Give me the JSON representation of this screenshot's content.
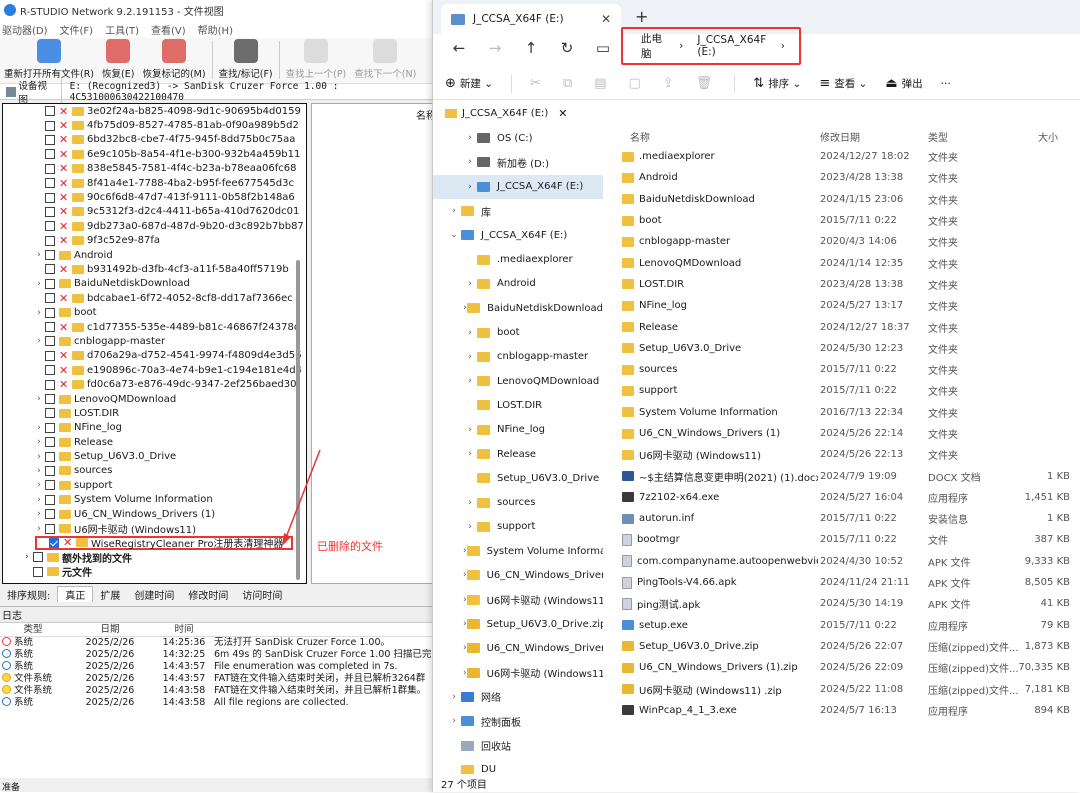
{
  "rstudio": {
    "title": "R-STUDIO Network 9.2.191153 - 文件视图",
    "menu": [
      "驱动器(D)",
      "文件(F)",
      "工具(T)",
      "查看(V)",
      "帮助(H)"
    ],
    "toolbar": [
      {
        "label": "重新打开所有文件(R)",
        "icon": "refresh-icon",
        "disabled": false
      },
      {
        "label": "恢复(E)",
        "icon": "recover-icon",
        "disabled": false
      },
      {
        "label": "恢复标记的(M)",
        "icon": "recover-marked-icon",
        "disabled": false
      },
      {
        "label": "查找/标记(F)",
        "icon": "binoculars-icon",
        "disabled": false
      },
      {
        "label": "查找上一个(P)",
        "icon": "find-prev-icon",
        "disabled": true
      },
      {
        "label": "查找下一个(N)",
        "icon": "find-next-icon",
        "disabled": true
      }
    ],
    "device_view": "设备视图",
    "path": "E: (Recognized3) -> SanDisk Cruzer Force 1.00 : 4C531000630422100470",
    "right_header": "名称",
    "tree": [
      {
        "name": "3e02f24a-b825-4098-9d1c-90695b4d0159",
        "deleted": true,
        "expand": false
      },
      {
        "name": "4fb75d09-8527-4785-81ab-0f90a989b5d2",
        "deleted": true,
        "expand": false
      },
      {
        "name": "6bd32bc8-cbe7-4f75-945f-8dd75b0c75aa",
        "deleted": true,
        "expand": false
      },
      {
        "name": "6e9c105b-8a54-4f1e-b300-932b4a459b11",
        "deleted": true,
        "expand": false
      },
      {
        "name": "838e5845-7581-4f4c-b23a-b78eaa06fc68",
        "deleted": true,
        "expand": false
      },
      {
        "name": "8f41a4e1-7788-4ba2-b95f-fee677545d3c",
        "deleted": true,
        "expand": false
      },
      {
        "name": "90c6f6d8-47d7-413f-9111-0b58f2b148a6",
        "deleted": true,
        "expand": false
      },
      {
        "name": "9c5312f3-d2c4-4411-b65a-410d7620dc01",
        "deleted": true,
        "expand": false
      },
      {
        "name": "9db273a0-687d-487d-9b20-d3c892b7bb87",
        "deleted": true,
        "expand": false
      },
      {
        "name": "9f3c52e9-87fa",
        "deleted": true,
        "expand": false
      },
      {
        "name": "Android",
        "deleted": false,
        "expand": true
      },
      {
        "name": "b931492b-d3fb-4cf3-a11f-58a40ff5719b",
        "deleted": true,
        "expand": false
      },
      {
        "name": "BaiduNetdiskDownload",
        "deleted": false,
        "expand": true
      },
      {
        "name": "bdcabae1-6f72-4052-8cf8-dd17af7366ec",
        "deleted": true,
        "expand": false
      },
      {
        "name": "boot",
        "deleted": false,
        "expand": true
      },
      {
        "name": "c1d77355-535e-4489-b81c-46867f24378c",
        "deleted": true,
        "expand": false
      },
      {
        "name": "cnblogapp-master",
        "deleted": false,
        "expand": true
      },
      {
        "name": "d706a29a-d752-4541-9974-f4809d4e3d56",
        "deleted": true,
        "expand": false
      },
      {
        "name": "e190896c-70a3-4e74-b9e1-c194e181e4d4",
        "deleted": true,
        "expand": false
      },
      {
        "name": "fd0c6a73-e876-49dc-9347-2ef256baed30",
        "deleted": true,
        "expand": false
      },
      {
        "name": "LenovoQMDownload",
        "deleted": false,
        "expand": true
      },
      {
        "name": "LOST.DIR",
        "deleted": false,
        "expand": false
      },
      {
        "name": "NFine_log",
        "deleted": false,
        "expand": true
      },
      {
        "name": "Release",
        "deleted": false,
        "expand": true
      },
      {
        "name": "Setup_U6V3.0_Drive",
        "deleted": false,
        "expand": true
      },
      {
        "name": "sources",
        "deleted": false,
        "expand": true
      },
      {
        "name": "support",
        "deleted": false,
        "expand": true
      },
      {
        "name": "System Volume Information",
        "deleted": false,
        "expand": true
      },
      {
        "name": "U6_CN_Windows_Drivers (1)",
        "deleted": false,
        "expand": true
      },
      {
        "name": "U6网卡驱动 (Windows11)",
        "deleted": false,
        "expand": true
      },
      {
        "name": "WiseRegistryCleaner Pro注册表清理神器",
        "deleted": true,
        "expand": false,
        "checked": true,
        "highlight": true
      }
    ],
    "tree_extra": [
      {
        "name": "额外找到的文件"
      },
      {
        "name": "元文件"
      }
    ],
    "deleted_annotation": "已删除的文件",
    "sort_label": "排序规则:",
    "sort_tabs": [
      "真正",
      "扩展",
      "创建时间",
      "修改时间",
      "访问时间"
    ],
    "log_title": "日志",
    "log_headers": [
      "类型",
      "日期",
      "时间"
    ],
    "log": [
      {
        "type": "系统",
        "kind": "error",
        "date": "2025/2/26",
        "time": "14:25:36",
        "msg": "无法打开 SanDisk Cruzer Force 1.00。"
      },
      {
        "type": "系统",
        "kind": "info",
        "date": "2025/2/26",
        "time": "14:32:25",
        "msg": "6m 49s 的 SanDisk Cruzer Force 1.00 扫描已完"
      },
      {
        "type": "系统",
        "kind": "info",
        "date": "2025/2/26",
        "time": "14:43:57",
        "msg": "File enumeration was completed in 7s."
      },
      {
        "type": "文件系统",
        "kind": "warn",
        "date": "2025/2/26",
        "time": "14:43:57",
        "msg": "FAT链在文件输入结束时关闭，并且已解析3264群"
      },
      {
        "type": "文件系统",
        "kind": "warn",
        "date": "2025/2/26",
        "time": "14:43:58",
        "msg": "FAT链在文件输入结束时关闭，并且已解析1群集。"
      },
      {
        "type": "系统",
        "kind": "info",
        "date": "2025/2/26",
        "time": "14:43:58",
        "msg": "All file regions are collected."
      }
    ],
    "status": "准备"
  },
  "explorer": {
    "tab_title": "J_CCSA_X64F (E:)",
    "breadcrumb": [
      "此电脑",
      "J_CCSA_X64F (E:)"
    ],
    "commands": {
      "new": "新建",
      "sort": "排序",
      "view": "查看",
      "eject": "弹出",
      "more": "···"
    },
    "subtab": "J_CCSA_X64F (E:)",
    "nav": [
      {
        "name": "OS (C:)",
        "level": 1,
        "chev": "›",
        "icon": "drive"
      },
      {
        "name": "新加卷 (D:)",
        "level": 1,
        "chev": "›",
        "icon": "drive"
      },
      {
        "name": "J_CCSA_X64F (E:)",
        "level": 1,
        "chev": "›",
        "icon": "usb",
        "selected": true
      },
      {
        "name": "库",
        "level": 0,
        "chev": "›",
        "icon": "folder"
      },
      {
        "name": "J_CCSA_X64F (E:)",
        "level": 0,
        "chev": "⌄",
        "icon": "usb"
      },
      {
        "name": ".mediaexplorer",
        "level": 1,
        "chev": "",
        "icon": "folder"
      },
      {
        "name": "Android",
        "level": 1,
        "chev": "›",
        "icon": "folder"
      },
      {
        "name": "BaiduNetdiskDownload",
        "level": 1,
        "chev": "›",
        "icon": "folder"
      },
      {
        "name": "boot",
        "level": 1,
        "chev": "›",
        "icon": "folder"
      },
      {
        "name": "cnblogapp-master",
        "level": 1,
        "chev": "›",
        "icon": "folder"
      },
      {
        "name": "LenovoQMDownload",
        "level": 1,
        "chev": "›",
        "icon": "folder"
      },
      {
        "name": "LOST.DIR",
        "level": 1,
        "chev": "",
        "icon": "folder"
      },
      {
        "name": "NFine_log",
        "level": 1,
        "chev": "›",
        "icon": "folder"
      },
      {
        "name": "Release",
        "level": 1,
        "chev": "›",
        "icon": "folder"
      },
      {
        "name": "Setup_U6V3.0_Drive",
        "level": 1,
        "chev": "",
        "icon": "folder"
      },
      {
        "name": "sources",
        "level": 1,
        "chev": "›",
        "icon": "folder"
      },
      {
        "name": "support",
        "level": 1,
        "chev": "›",
        "icon": "folder"
      },
      {
        "name": "System Volume Informa",
        "level": 1,
        "chev": "›",
        "icon": "folder"
      },
      {
        "name": "U6_CN_Windows_Drivers",
        "level": 1,
        "chev": "›",
        "icon": "folder"
      },
      {
        "name": "U6网卡驱动 (Windows11",
        "level": 1,
        "chev": "›",
        "icon": "folder"
      },
      {
        "name": "Setup_U6V3.0_Drive.zip",
        "level": 1,
        "chev": "›",
        "icon": "zip"
      },
      {
        "name": "U6_CN_Windows_Drivers",
        "level": 1,
        "chev": "›",
        "icon": "zip"
      },
      {
        "name": "U6网卡驱动 (Windows11",
        "level": 1,
        "chev": "›",
        "icon": "zip"
      },
      {
        "name": "网络",
        "level": 0,
        "chev": "›",
        "icon": "network"
      },
      {
        "name": "控制面板",
        "level": 0,
        "chev": "›",
        "icon": "control"
      },
      {
        "name": "回收站",
        "level": 0,
        "chev": "",
        "icon": "recycle"
      },
      {
        "name": "DU",
        "level": 0,
        "chev": "",
        "icon": "folder"
      }
    ],
    "columns": [
      "名称",
      "修改日期",
      "类型",
      "大小"
    ],
    "files": [
      {
        "name": ".mediaexplorer",
        "date": "2024/12/27 18:02",
        "type": "文件夹",
        "size": "",
        "icon": "folder"
      },
      {
        "name": "Android",
        "date": "2023/4/28 13:38",
        "type": "文件夹",
        "size": "",
        "icon": "folder"
      },
      {
        "name": "BaiduNetdiskDownload",
        "date": "2024/1/15 23:06",
        "type": "文件夹",
        "size": "",
        "icon": "folder"
      },
      {
        "name": "boot",
        "date": "2015/7/11 0:22",
        "type": "文件夹",
        "size": "",
        "icon": "folder"
      },
      {
        "name": "cnblogapp-master",
        "date": "2020/4/3 14:06",
        "type": "文件夹",
        "size": "",
        "icon": "folder"
      },
      {
        "name": "LenovoQMDownload",
        "date": "2024/1/14 12:35",
        "type": "文件夹",
        "size": "",
        "icon": "folder"
      },
      {
        "name": "LOST.DIR",
        "date": "2023/4/28 13:38",
        "type": "文件夹",
        "size": "",
        "icon": "folder"
      },
      {
        "name": "NFine_log",
        "date": "2024/5/27 13:17",
        "type": "文件夹",
        "size": "",
        "icon": "folder"
      },
      {
        "name": "Release",
        "date": "2024/12/27 18:37",
        "type": "文件夹",
        "size": "",
        "icon": "folder"
      },
      {
        "name": "Setup_U6V3.0_Drive",
        "date": "2024/5/30 12:23",
        "type": "文件夹",
        "size": "",
        "icon": "folder"
      },
      {
        "name": "sources",
        "date": "2015/7/11 0:22",
        "type": "文件夹",
        "size": "",
        "icon": "folder"
      },
      {
        "name": "support",
        "date": "2015/7/11 0:22",
        "type": "文件夹",
        "size": "",
        "icon": "folder"
      },
      {
        "name": "System Volume Information",
        "date": "2016/7/13 22:34",
        "type": "文件夹",
        "size": "",
        "icon": "folder"
      },
      {
        "name": "U6_CN_Windows_Drivers (1)",
        "date": "2024/5/26 22:14",
        "type": "文件夹",
        "size": "",
        "icon": "folder"
      },
      {
        "name": "U6网卡驱动 (Windows11)",
        "date": "2024/5/26 22:13",
        "type": "文件夹",
        "size": "",
        "icon": "folder"
      },
      {
        "name": "~$主结算信息变更申明(2021) (1).docx",
        "date": "2024/7/9 19:09",
        "type": "DOCX 文档",
        "size": "1 KB",
        "icon": "docx"
      },
      {
        "name": "7z2102-x64.exe",
        "date": "2024/5/27 16:04",
        "type": "应用程序",
        "size": "1,451 KB",
        "icon": "exe"
      },
      {
        "name": "autorun.inf",
        "date": "2015/7/11 0:22",
        "type": "安装信息",
        "size": "1 KB",
        "icon": "inf"
      },
      {
        "name": "bootmgr",
        "date": "2015/7/11 0:22",
        "type": "文件",
        "size": "387 KB",
        "icon": "file"
      },
      {
        "name": "com.companyname.autoopenwebvie...",
        "date": "2024/4/30 10:52",
        "type": "APK 文件",
        "size": "9,333 KB",
        "icon": "file"
      },
      {
        "name": "PingTools-V4.66.apk",
        "date": "2024/11/24 21:11",
        "type": "APK 文件",
        "size": "8,505 KB",
        "icon": "file"
      },
      {
        "name": "ping测试.apk",
        "date": "2024/5/30 14:19",
        "type": "APK 文件",
        "size": "41 KB",
        "icon": "file"
      },
      {
        "name": "setup.exe",
        "date": "2015/7/11 0:22",
        "type": "应用程序",
        "size": "79 KB",
        "icon": "setup"
      },
      {
        "name": "Setup_U6V3.0_Drive.zip",
        "date": "2024/5/26 22:07",
        "type": "压缩(zipped)文件...",
        "size": "1,873 KB",
        "icon": "zip"
      },
      {
        "name": "U6_CN_Windows_Drivers (1).zip",
        "date": "2024/5/26 22:09",
        "type": "压缩(zipped)文件...",
        "size": "70,335 KB",
        "icon": "zip"
      },
      {
        "name": "U6网卡驱动 (Windows11) .zip",
        "date": "2024/5/22 11:08",
        "type": "压缩(zipped)文件...",
        "size": "7,181 KB",
        "icon": "zip"
      },
      {
        "name": "WinPcap_4_1_3.exe",
        "date": "2024/5/7 16:13",
        "type": "应用程序",
        "size": "894 KB",
        "icon": "exe"
      }
    ],
    "status": "27 个项目"
  }
}
